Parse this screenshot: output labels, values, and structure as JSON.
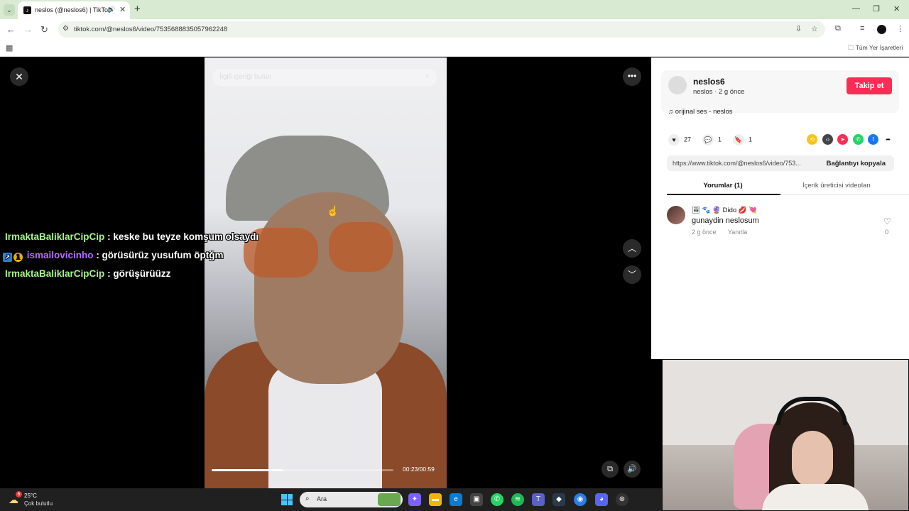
{
  "browser": {
    "tab_title": "neslos (@neslos6) | TikTok",
    "url": "tiktok.com/@neslos6/video/7535688835057962248",
    "bookmarks_folder": "Tüm Yer İşaretleri"
  },
  "video": {
    "search_placeholder": "İlgili içeriği bulun",
    "time": "00:23/00:59",
    "progress": 0.39
  },
  "chat": [
    {
      "user": "IrmaktaBaliklarCipCip",
      "message": ": keske bu teyze komşum olsaydı"
    },
    {
      "user": "ismailovicinho",
      "message": ": görüsürüz yusufum öptğm"
    },
    {
      "user": "IrmaktaBaliklarCipCip",
      "message": ": görüşürüüzz"
    }
  ],
  "author": {
    "name": "neslos6",
    "sub": "neslos · 2 g önce",
    "follow_label": "Takip et",
    "music": "orijinal ses - neslos"
  },
  "stats": {
    "likes": "27",
    "comments": "1",
    "saves": "1"
  },
  "share": {
    "link": "https://www.tiktok.com/@neslos6/video/753...",
    "copy_label": "Bağlantıyı kopyala"
  },
  "panel_tabs": {
    "comments": "Yorumlar (1)",
    "creator_videos": "İçerik üreticisi videoları"
  },
  "comment": {
    "user": "Dido",
    "text": "gunaydin neslosum",
    "time": "2 g önce",
    "reply_label": "Yanıtla",
    "likes": "0"
  },
  "taskbar": {
    "weather_badge": "6",
    "temperature": "25°C",
    "weather": "Çok bulutlu",
    "search_label": "Ara"
  },
  "colors": {
    "follow_red": "#fe2c55",
    "chat_green": "#a6f28a",
    "chat_purple": "#b46cff"
  }
}
